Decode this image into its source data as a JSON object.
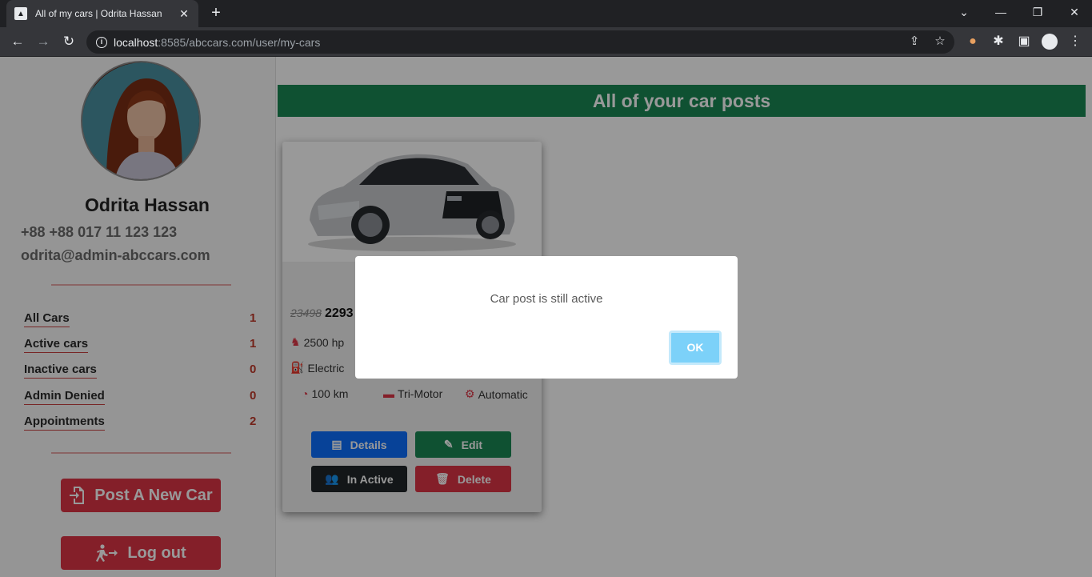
{
  "browser": {
    "tab_title": "All of my cars | Odrita Hassan",
    "url_host": "localhost",
    "url_rest": ":8585/abccars.com/user/my-cars"
  },
  "profile": {
    "name": "Odrita Hassan",
    "phone": "+88 +88 017 11 123 123",
    "email": "odrita@admin-abccars.com"
  },
  "sidebar": {
    "items": [
      {
        "label": "All Cars",
        "count": "1"
      },
      {
        "label": "Active cars",
        "count": "1"
      },
      {
        "label": "Inactive cars",
        "count": "0"
      },
      {
        "label": "Admin Denied",
        "count": "0"
      },
      {
        "label": "Appointments",
        "count": "2"
      }
    ],
    "post_button": "Post A New Car",
    "logout_button": "Log out"
  },
  "main": {
    "banner": "All of your car posts"
  },
  "card": {
    "old_price": "23498",
    "price": "2293",
    "horsepower": "2500 hp",
    "fuel": "Electric",
    "mileage": "100 km",
    "motor": "Tri-Motor",
    "transmission": "Automatic",
    "details_button": "Details",
    "edit_button": "Edit",
    "inactive_button": "In Active",
    "delete_button": "Delete"
  },
  "modal": {
    "message": "Car post is still active",
    "ok_button": "OK"
  },
  "colors": {
    "banner": "#198754",
    "danger": "#dc3545",
    "primary": "#0d6efd",
    "success": "#198754",
    "dark": "#212529",
    "ok_button": "#7cd1f9"
  }
}
